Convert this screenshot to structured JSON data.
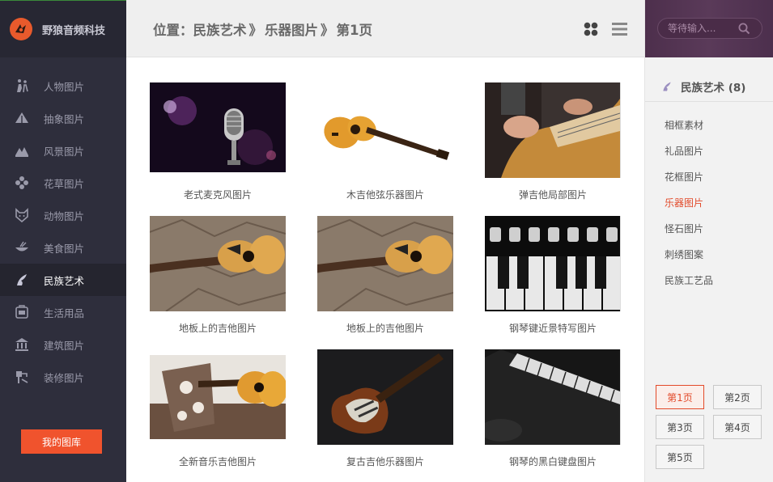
{
  "brand": {
    "name": "野狼音频科技"
  },
  "nav": [
    {
      "label": "人物图片",
      "icon": "person-icon"
    },
    {
      "label": "抽象图片",
      "icon": "abstract-icon"
    },
    {
      "label": "风景图片",
      "icon": "landscape-icon"
    },
    {
      "label": "花草图片",
      "icon": "flower-icon"
    },
    {
      "label": "动物图片",
      "icon": "animal-icon"
    },
    {
      "label": "美食图片",
      "icon": "food-icon"
    },
    {
      "label": "民族艺术",
      "icon": "ethnic-art-icon",
      "active": true
    },
    {
      "label": "生活用品",
      "icon": "daily-goods-icon"
    },
    {
      "label": "建筑图片",
      "icon": "building-icon"
    },
    {
      "label": "装修图片",
      "icon": "decoration-icon"
    }
  ],
  "my_library": "我的图库",
  "breadcrumb": {
    "prefix": "位置：",
    "level1": "民族艺术",
    "sep": "》",
    "level2": "乐器图片",
    "level3": "第1页"
  },
  "search": {
    "placeholder": "等待输入..."
  },
  "category": {
    "title": "民族艺术 (8)",
    "items": [
      {
        "label": "相框素材"
      },
      {
        "label": "礼品图片"
      },
      {
        "label": "花框图片"
      },
      {
        "label": "乐器图片",
        "active": true
      },
      {
        "label": "怪石图片"
      },
      {
        "label": "刺绣图案"
      },
      {
        "label": "民族工艺品"
      }
    ]
  },
  "pagination": [
    "第1页",
    "第2页",
    "第3页",
    "第4页",
    "第5页"
  ],
  "gallery": [
    {
      "caption": "老式麦克风图片"
    },
    {
      "caption": "木吉他弦乐器图片"
    },
    {
      "caption": "弹吉他局部图片"
    },
    {
      "caption": "地板上的吉他图片"
    },
    {
      "caption": "地板上的吉他图片"
    },
    {
      "caption": "钢琴键近景特写图片"
    },
    {
      "caption": "全新音乐吉他图片"
    },
    {
      "caption": "复古吉他乐器图片"
    },
    {
      "caption": "钢琴的黑白键盘图片"
    }
  ],
  "colors": {
    "accent": "#f0532d",
    "sidebar": "#2e2e3c",
    "search_bg": "#4d2f4c"
  }
}
